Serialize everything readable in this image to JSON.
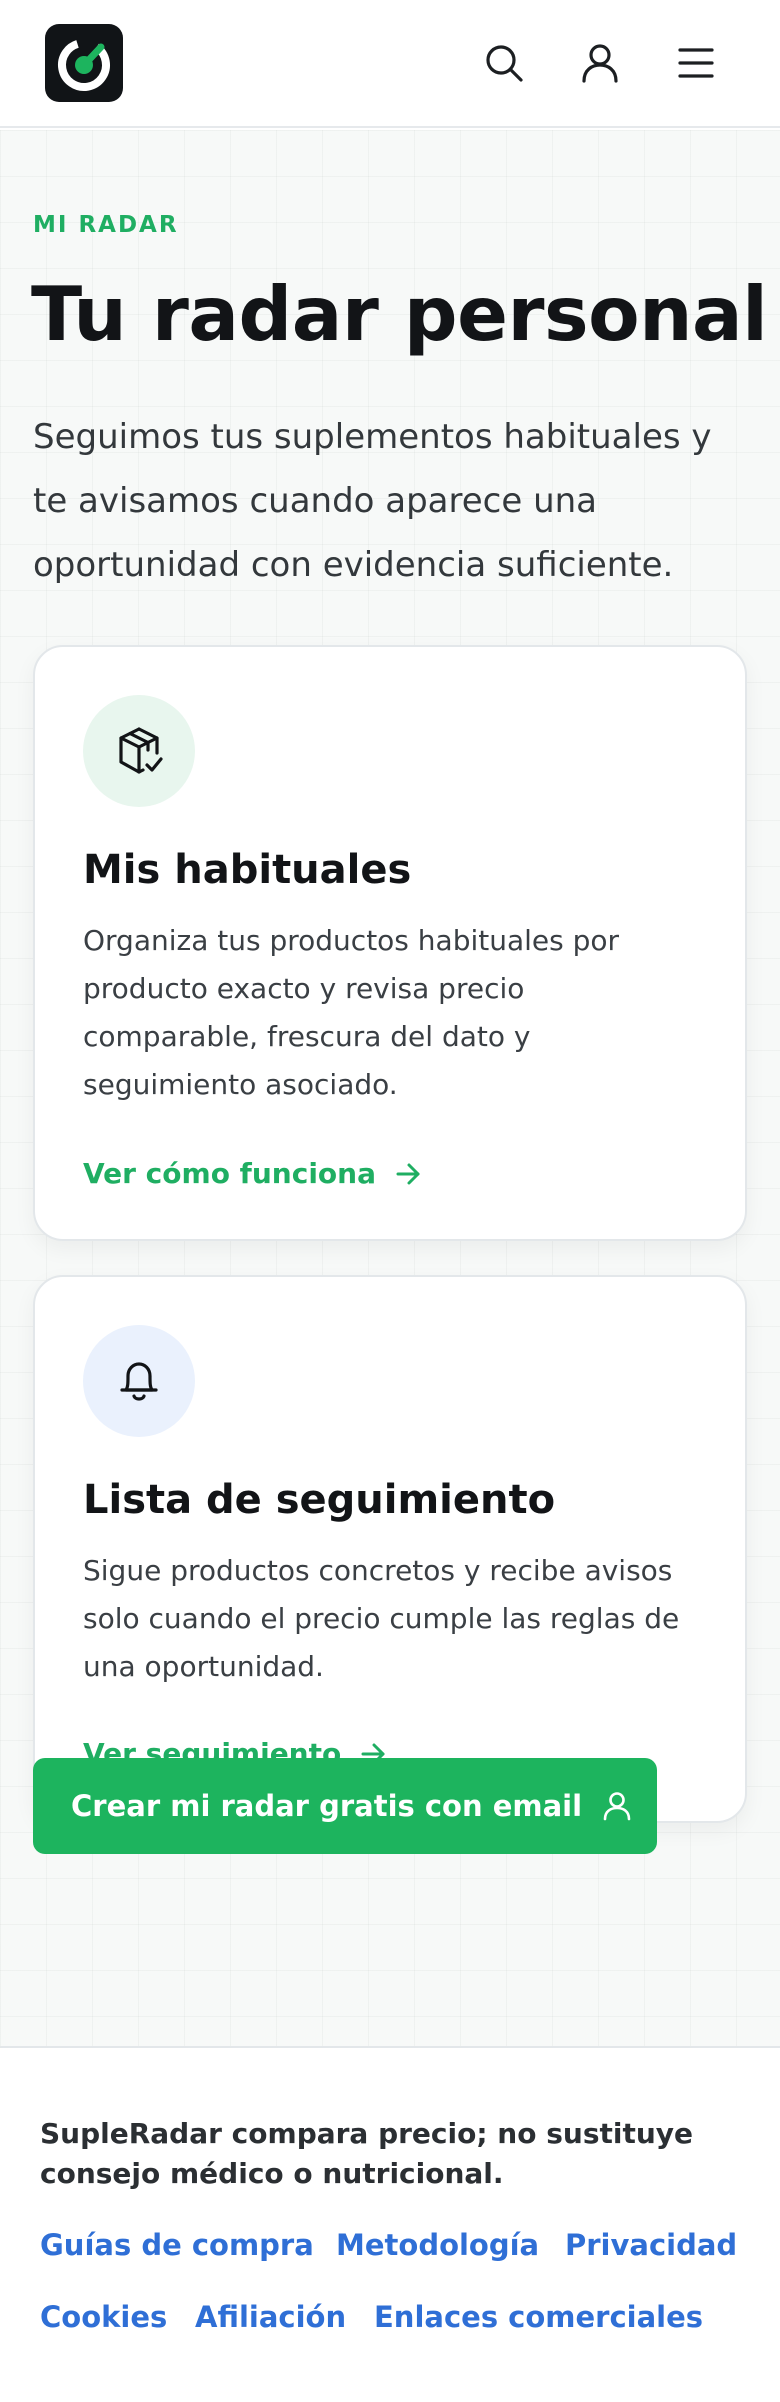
{
  "header": {
    "logo_icon": "radar-logo-icon",
    "icons": [
      "search-icon",
      "user-icon",
      "menu-icon"
    ]
  },
  "hero": {
    "eyebrow": "MI RADAR",
    "title": "Tu radar personal",
    "subtitle": "Seguimos tus suplementos habituales y te avisamos cuando aparece una oportunidad con evidencia suficiente."
  },
  "cards": [
    {
      "icon": "package-check-icon",
      "title": "Mis habituales",
      "text": "Organiza tus productos habituales por producto exacto y revisa precio comparable, frescura del dato y seguimiento asociado.",
      "link": "Ver cómo funciona"
    },
    {
      "icon": "bell-icon",
      "title": "Lista de seguimiento",
      "text": "Sigue productos concretos y recibe avisos solo cuando el precio cumple las reglas de una oportunidad.",
      "link": "Ver seguimiento"
    }
  ],
  "cta": {
    "label": "Crear mi radar gratis con email",
    "icon": "user-icon"
  },
  "footer": {
    "disclaimer": "SupleRadar compara precio; no sustituye consejo médico o nutricional.",
    "links": [
      "Guías de compra",
      "Metodología",
      "Privacidad",
      "Cookies",
      "Afiliación",
      "Enlaces comerciales"
    ]
  },
  "colors": {
    "accent": "#1db45e",
    "link": "#2f6fd6",
    "text": "#121417"
  }
}
